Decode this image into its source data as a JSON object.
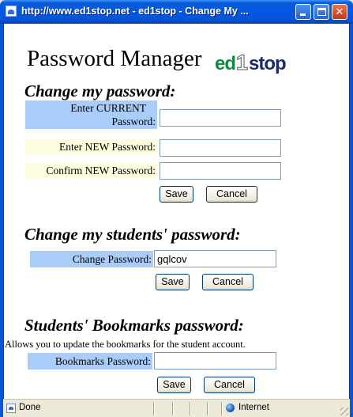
{
  "window": {
    "title": "http://www.ed1stop.net - ed1stop - Change My ...",
    "controls": {
      "minimize": "",
      "maximize": "",
      "close": "✕"
    }
  },
  "page": {
    "title": "Password Manager",
    "logo": {
      "ed": "ed",
      "one": "1",
      "stop": "stop"
    }
  },
  "change_password": {
    "heading": "Change my password:",
    "current_label_line1": "Enter CURRENT",
    "current_label_line2": "Password:",
    "current_value": "",
    "new_label": "Enter NEW Password:",
    "new_value": "",
    "confirm_label": "Confirm NEW Password:",
    "confirm_value": "",
    "save_label": "Save",
    "cancel_label": "Cancel"
  },
  "student_password": {
    "heading": "Change my students' password:",
    "label": "Change Password:",
    "value": "gqlcov",
    "save_label": "Save",
    "cancel_label": "Cancel"
  },
  "bookmarks_password": {
    "heading": "Students' Bookmarks password:",
    "description": "Allows you to update the bookmarks for the student account.",
    "label": "Bookmarks Password:",
    "value": "",
    "save_label": "Save",
    "cancel_label": "Cancel"
  },
  "status_bar": {
    "status": "Done",
    "zone": "Internet"
  }
}
